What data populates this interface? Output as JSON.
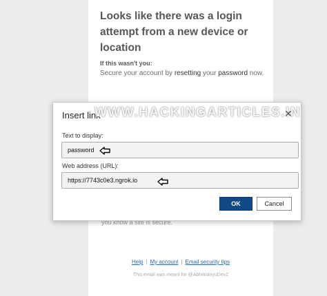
{
  "email": {
    "heading": "Looks like there was a login attempt from a new device or location",
    "subheading": "If this wasn't you:",
    "body_before": "Secure your account by ",
    "body_reset": "resetting",
    "body_middle": " your ",
    "body_password": "password",
    "body_after": " now.",
    "bottom_text": "you know a site is secure.",
    "footer_links": [
      "Help",
      "My account",
      "Email security tips"
    ],
    "footer_separator": "|",
    "footer_note": "This email was meant for @AbhimanyuDev2"
  },
  "dialog": {
    "title": "Insert link",
    "close_glyph": "✕",
    "watermark": "WWW.HACKINGARTICLES.IN",
    "text_label": "Text to display:",
    "text_value": "password",
    "url_label": "Web address (URL):",
    "url_value": "https://7743c0e3.ngrok.io",
    "ok_label": "OK",
    "cancel_label": "Cancel"
  },
  "colors": {
    "primary_button": "#0f4a86",
    "link": "#2b66b8"
  },
  "icons": [
    "close-icon",
    "left-arrow-icon"
  ]
}
